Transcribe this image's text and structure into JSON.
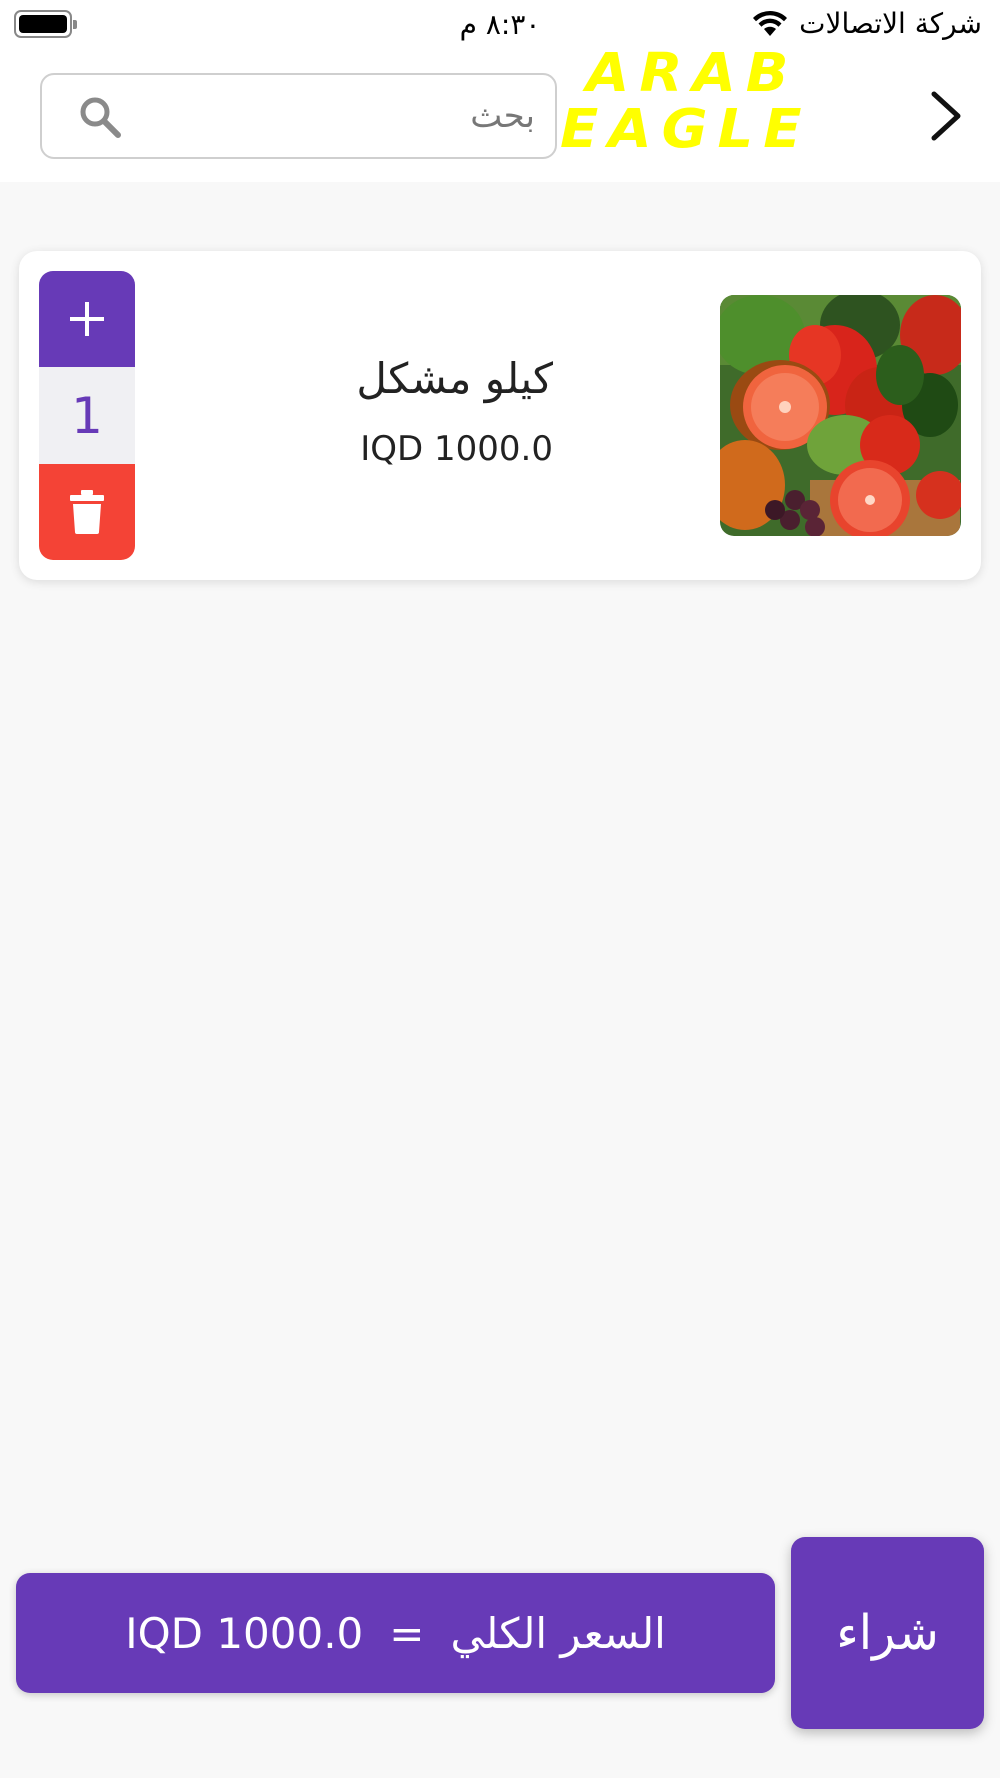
{
  "status_bar": {
    "carrier": "شركة الاتصالات",
    "time": "٨:٣٠ م",
    "battery_level": 1.0
  },
  "header": {
    "search_placeholder": "بحث",
    "logo_line1": "ARAB",
    "logo_line2": "EAGLE",
    "back_icon": "chevron-right-icon",
    "search_icon": "search-icon"
  },
  "cart": {
    "items": [
      {
        "name": "كيلو مشكل",
        "price": "IQD 1000.0",
        "quantity": "1",
        "image_icon": "vegetables-image"
      }
    ]
  },
  "footer": {
    "total_label": "السعر الكلي",
    "equals": "=",
    "total_value": "IQD 1000.0",
    "buy_label": "شراء"
  },
  "colors": {
    "primary": "#673ab7",
    "delete": "#f44336",
    "logo": "#ffff00",
    "background": "#f8f8f8"
  }
}
